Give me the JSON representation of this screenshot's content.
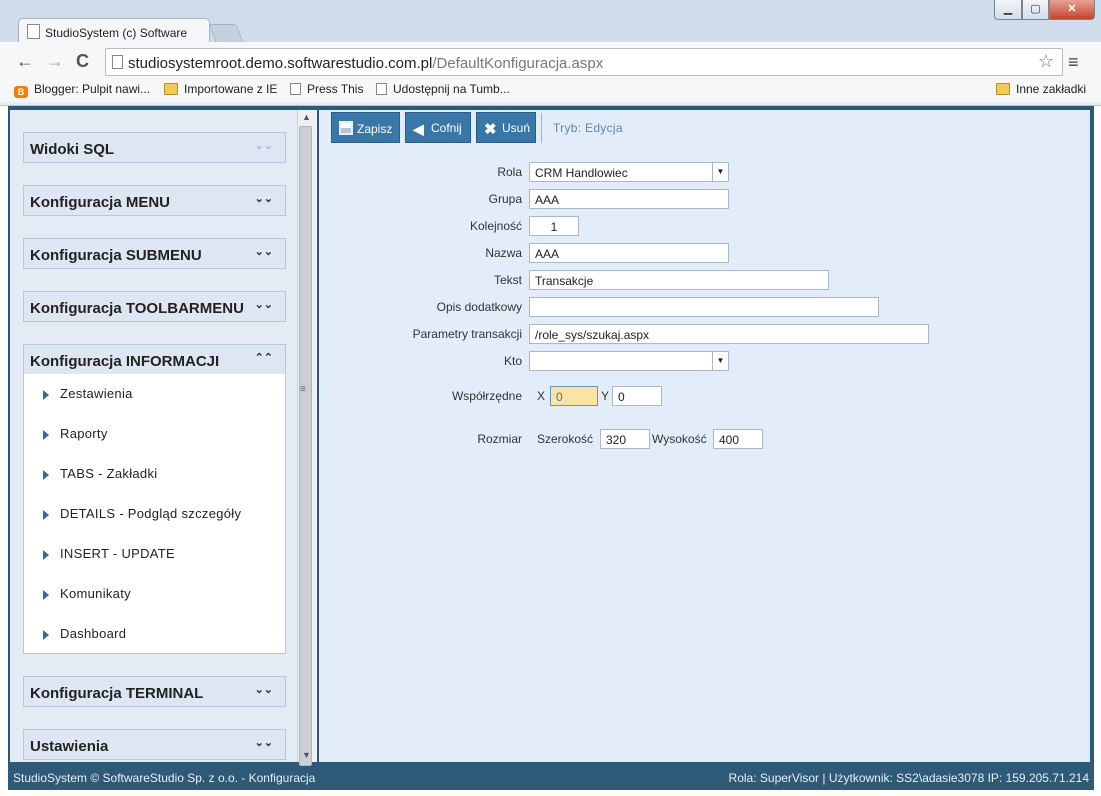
{
  "window": {
    "tab_title": "StudioSystem (c) Software",
    "min_label": "▁",
    "max_label": "▢",
    "close_label": "✕"
  },
  "browser": {
    "back": "←",
    "forward": "→",
    "reload": "C",
    "url_host": "studiosystemroot.demo.softwarestudio.com.pl",
    "url_path": "/DefaultKonfiguracja.aspx",
    "star": "☆",
    "menu": "≡",
    "bookmarks": [
      {
        "label": "Blogger: Pulpit nawi...",
        "icon": "blogger-icon"
      },
      {
        "label": "Importowane z IE",
        "icon": "folder-icon"
      },
      {
        "label": "Press This",
        "icon": "page-icon"
      },
      {
        "label": "Udostępnij na Tumb...",
        "icon": "page-icon"
      }
    ],
    "other_bookmarks": "Inne zakładki"
  },
  "sidebar": {
    "sections": [
      {
        "label": "Widoki SQL",
        "chevron": "⌄⌄"
      },
      {
        "label": "Konfiguracja MENU",
        "chevron": "⌄⌄"
      },
      {
        "label": "Konfiguracja SUBMENU",
        "chevron": "⌄⌄"
      },
      {
        "label": "Konfiguracja TOOLBARMENU",
        "chevron": "⌄⌄"
      },
      {
        "label": "Konfiguracja INFORMACJI",
        "chevron": "⌃⌃"
      },
      {
        "label": "Konfiguracja TERMINAL",
        "chevron": "⌄⌄"
      },
      {
        "label": "Ustawienia",
        "chevron": "⌄⌄"
      }
    ],
    "open_items": [
      "Zestawienia",
      "Raporty",
      "TABS - Zakładki",
      "DETAILS - Podgląd szczegóły",
      "INSERT - UPDATE",
      "Komunikaty",
      "Dashboard"
    ]
  },
  "toolbar": {
    "save_label": "Zapisz",
    "back_label": "Cofnij",
    "delete_label": "Usuń",
    "mode_text": "Tryb: Edycja"
  },
  "form": {
    "rola": {
      "label": "Rola",
      "value": "CRM Handlowiec"
    },
    "grupa": {
      "label": "Grupa",
      "value": "AAA"
    },
    "kolejnosc": {
      "label": "Kolejność",
      "value": "1"
    },
    "nazwa": {
      "label": "Nazwa",
      "value": "AAA"
    },
    "tekst": {
      "label": "Tekst",
      "value": "Transakcje"
    },
    "opis": {
      "label": "Opis dodatkowy",
      "value": ""
    },
    "parametry": {
      "label": "Parametry transakcji",
      "value": "/role_sys/szukaj.aspx"
    },
    "kto": {
      "label": "Kto",
      "value": ""
    },
    "wspolrzedne": {
      "label": "Współrzędne",
      "x_label": "X",
      "x_value": "0",
      "y_label": "Y",
      "y_value": "0"
    },
    "rozmiar": {
      "label": "Rozmiar",
      "w_label": "Szerokość",
      "w_value": "320",
      "h_label": "Wysokość",
      "h_value": "400"
    }
  },
  "status": {
    "left": "StudioSystem © SoftwareStudio Sp. z o.o. - Konfiguracja",
    "right": "Rola: SuperVisor | Użytkownik: SS2\\adasie3078 IP: 159.205.71.214"
  }
}
